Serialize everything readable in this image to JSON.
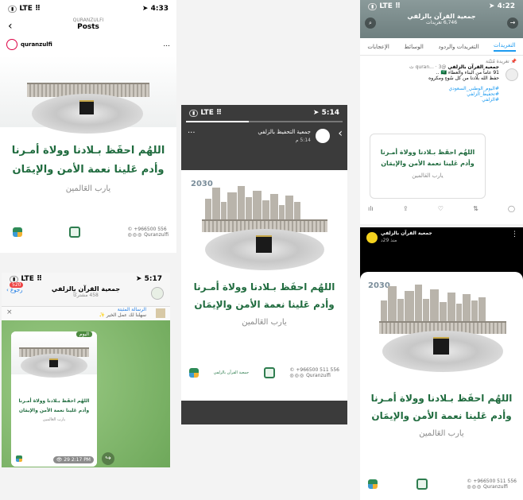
{
  "instagram": {
    "status": {
      "lte": "LTE",
      "time": "4:33"
    },
    "account_header": "QURANZULFI",
    "title": "Posts",
    "username": "quranzulfi",
    "menu": "...",
    "prayer_line1": "اللهُم احفَظ بـلادنا وولاة أمـرنا",
    "prayer_line2": "وأدم عَلينا نعمة الأمن والإيمَان",
    "prayer_line3": "يارب العَالمين",
    "phone": "+966500 556",
    "handle": "Quranzulfi"
  },
  "story": {
    "status": {
      "lte": "LTE",
      "time": "5:14"
    },
    "account": "جمعية التحفيظ بالزلفي",
    "time_ago": "5:14 م",
    "prayer_line1": "اللهُم احفَظ بـلادنا وولاة أمـرنا",
    "prayer_line2": "وأدم عَلينا نعمة الأمن والإيمَان",
    "prayer_line3": "يارب العَالمين",
    "org_name": "جمعية القرآن بالزلفي",
    "phone": "+966500 511 556",
    "handle": "Quranzulfi",
    "vision": "2030"
  },
  "twitter": {
    "status": {
      "lte": "LTE",
      "time": "4:22"
    },
    "account_name": "جمعية القرآن بالزلفي",
    "tweet_count": "6,746 تغريدات",
    "tabs": [
      "الإعجابات",
      "الوسائط",
      "التغريدات والردود",
      "التغريدات"
    ],
    "pinned": "تغريدة مُثبّتة",
    "tweet_author": "جمعية القرآن بالزلفي",
    "tweet_handle": "@quran... · 3 ث",
    "tweet_line1": "91 عاماً من البناء والعطاء 🇸🇦 ..",
    "tweet_line2": "حفظ الله بلادنا من كل سُوءٍ ومكروه",
    "hashtags": [
      "#اليوم_الوطني_السعودي",
      "#تحفيظ_الزلفي",
      "#الزلفي"
    ],
    "card_line1": "اللهُم احفَظ بـلادنا وولاة أمـرنا",
    "card_line2": "وأدم عَلينا نعمة الأمن والإيمَان",
    "card_line3": "يارب العَالمين",
    "actions": [
      "ılı",
      "⇪",
      "♡",
      "⇅",
      "◯"
    ]
  },
  "telegram": {
    "status": {
      "lte": "LTE",
      "time": "5:17"
    },
    "back": "رجوع",
    "badge": "520",
    "channel_name": "جمعية القرآن بالزلفي",
    "members": "458 مشتركاً",
    "pinned_title": "الرسالة المثبتة",
    "pinned_text": "سهلنا لك عمل الخير ✨",
    "day_label": "اليوم",
    "card_line1": "اللهُم احفَظ بـلادنا وولاة أمـرنا",
    "card_line2": "وأدم عَلينا نعمة الأمن والإيمَان",
    "card_line3": "يارب العَالمين",
    "views": "29",
    "msg_time": "2:17 PM"
  },
  "snap": {
    "account": "جمعية القرآن بالزلفي",
    "time_ago": "منذ 29د",
    "vision": "2030",
    "prayer_line1": "اللهُم احفَظ بـلادنا وولاة أمـرنا",
    "prayer_line2": "وأدم عَلينا نعمة الأمن والإيمَان",
    "prayer_line3": "يارب العَالمين",
    "phone": "+966500 511 556",
    "handle": "Quranzulfi"
  },
  "colors": {
    "brand_green": "#1f6b3e",
    "twitter_blue": "#1d9bf0",
    "telegram_green": "#7fb56a"
  }
}
